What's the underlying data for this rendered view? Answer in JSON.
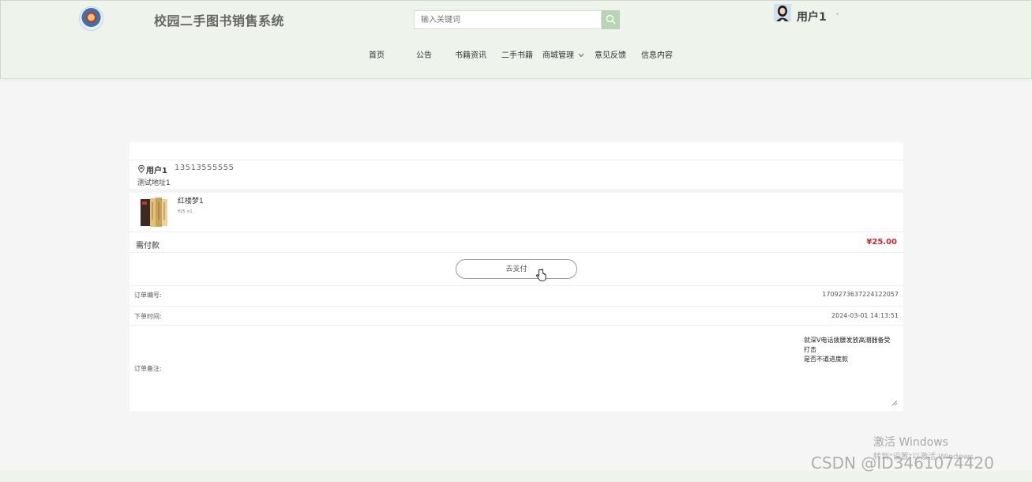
{
  "header": {
    "site_title": "校园二手图书销售系统",
    "search_placeholder": "输入关键词",
    "user_name": "用户1",
    "user_caret": "-"
  },
  "nav": {
    "items": [
      {
        "label": "首页"
      },
      {
        "label": "公告"
      },
      {
        "label": "书籍资讯"
      },
      {
        "label": "二手书籍"
      },
      {
        "label": "商城管理"
      },
      {
        "label": "意见反馈"
      },
      {
        "label": "信息内容"
      }
    ]
  },
  "order": {
    "address": {
      "name": "用户1",
      "phone": "13513555555",
      "detail": "测试地址1"
    },
    "item": {
      "title": "红楼梦1",
      "meta": "¥25 ×1"
    },
    "payable_label": "需付款",
    "payable_amount": "¥25.00",
    "pay_button": "去支付",
    "order_no_label": "订单编号:",
    "order_no": "1709273637224122057",
    "order_time_label": "下单时间:",
    "order_time": "2024-03-01 14:13:51",
    "remark_label": "订单备注:",
    "remark_text": "就深V电话拨腰发放高潮器备受\n打击\n是否不道进度款"
  },
  "watermarks": {
    "windows_title": "激活 Windows",
    "windows_sub": "转到\"设置\"以激活 Windows。",
    "csdn": "CSDN @ID3461074420"
  },
  "colors": {
    "header_bg": "#eef4ec",
    "accent_price": "#d8232a",
    "search_button": "#b9d4b2"
  }
}
